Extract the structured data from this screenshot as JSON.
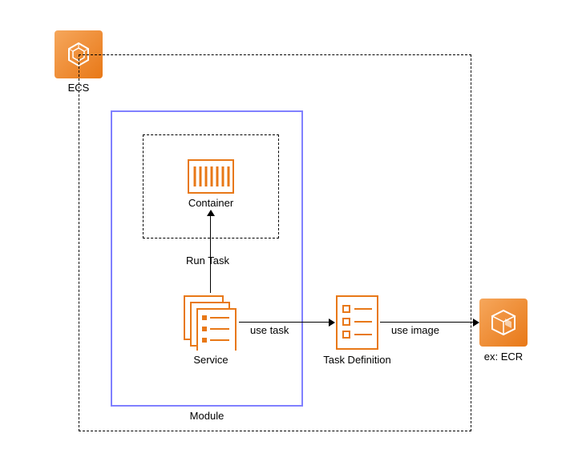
{
  "ecs": {
    "label": "ECS"
  },
  "module": {
    "label": "Module"
  },
  "container": {
    "label": "Container"
  },
  "service": {
    "label": "Service"
  },
  "task_definition": {
    "label": "Task Definition"
  },
  "ecr": {
    "label": "ex: ECR"
  },
  "arrow_run_task": {
    "label": "Run Task"
  },
  "arrow_use_task": {
    "label": "use task"
  },
  "arrow_use_image": {
    "label": "use image"
  },
  "colors": {
    "aws_orange": "#e87817",
    "purple": "#8080ff"
  }
}
